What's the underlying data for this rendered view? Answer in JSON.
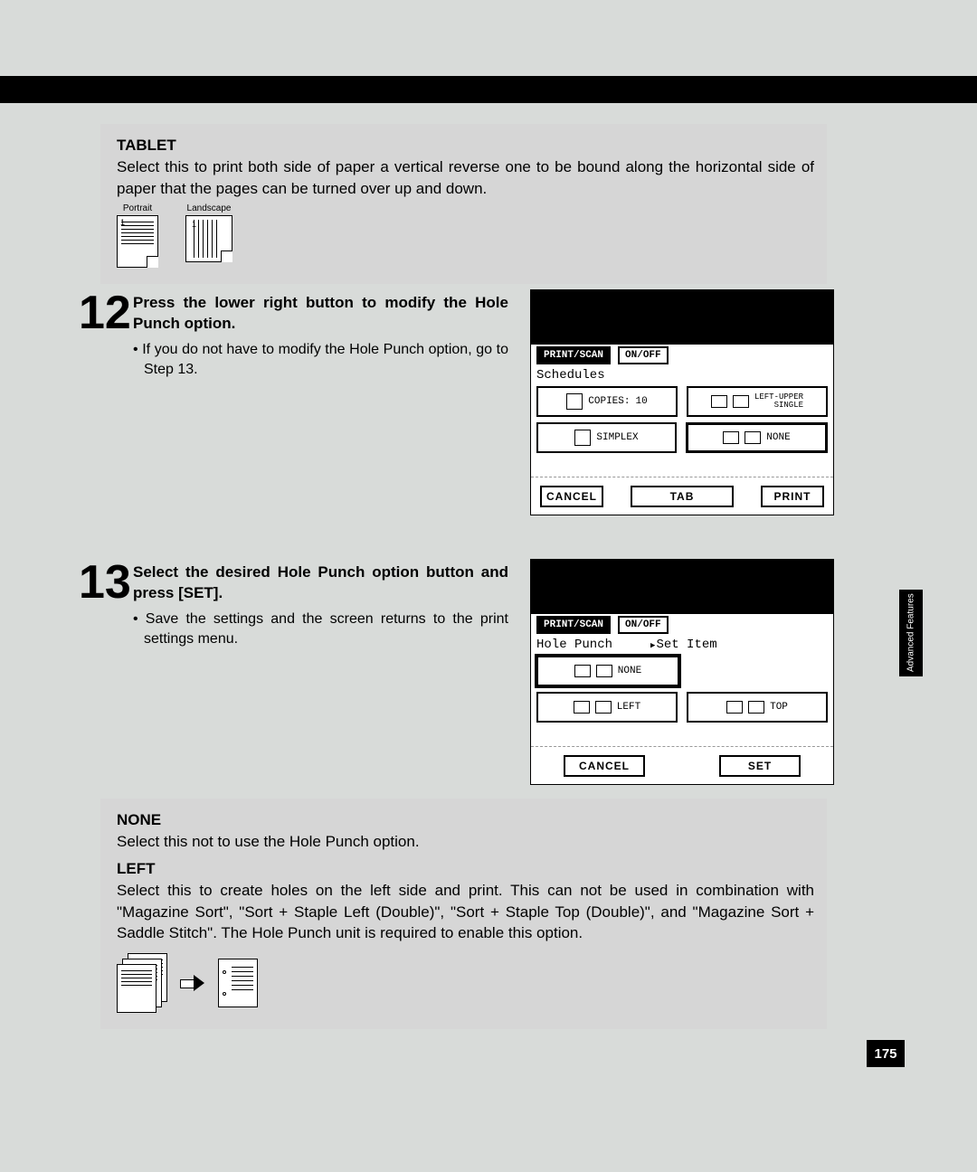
{
  "tablet": {
    "heading": "TABLET",
    "body": "Select this to print both side of paper a vertical reverse one to be bound along the horizontal side of paper that the pages can be turned over up and down.",
    "portrait_label": "Portrait",
    "landscape_label": "Landscape"
  },
  "step12": {
    "num": "12",
    "title": "Press the lower right button to modify the Hole Punch option.",
    "bullet": "• If you do not have to modify the Hole Punch option, go to Step 13."
  },
  "lcd12": {
    "tab1": "PRINT/SCAN",
    "tab2": "ON/OFF",
    "title": "Schedules",
    "copies_label": "COPIES:",
    "copies_value": "10",
    "staple_label": "LEFT-UPPER\nSINGLE",
    "simplex": "SIMPLEX",
    "none": "NONE",
    "btn_cancel": "CANCEL",
    "btn_tab": "TAB",
    "btn_print": "PRINT"
  },
  "step13": {
    "num": "13",
    "title": "Select the desired Hole Punch option button and press [SET].",
    "bullet": "• Save the settings and the screen returns to the print settings menu."
  },
  "lcd13": {
    "tab1": "PRINT/SCAN",
    "tab2": "ON/OFF",
    "title_left": "Hole Punch",
    "title_right": "Set Item",
    "opt_none": "NONE",
    "opt_left": "LEFT",
    "opt_top": "TOP",
    "btn_cancel": "CANCEL",
    "btn_set": "SET"
  },
  "options": {
    "none_h": "NONE",
    "none_body": "Select this not to use the Hole Punch option.",
    "left_h": "LEFT",
    "left_body": "Select this to create holes on the left side and print.  This can not be used in combination with \"Magazine Sort\", \"Sort + Staple Left (Double)\", \"Sort + Staple Top (Double)\", and \"Magazine Sort + Saddle Stitch\".  The Hole Punch unit is required to enable this option."
  },
  "side_tab": "Advanced Features",
  "page_num": "175"
}
